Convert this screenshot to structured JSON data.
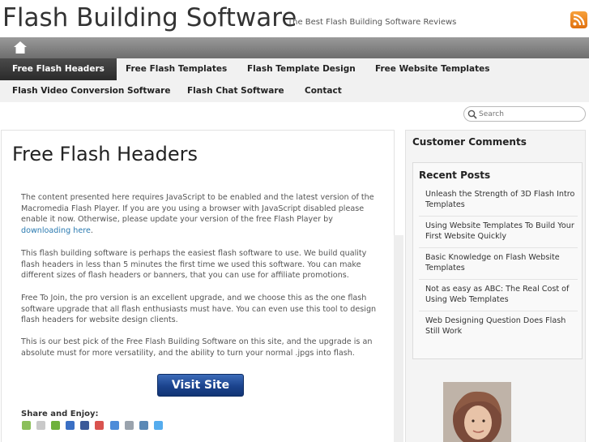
{
  "header": {
    "site_title": "Flash Building Software",
    "tagline": "The Best Flash Building Software Reviews"
  },
  "nav": {
    "items": [
      {
        "label": "Free Flash Headers",
        "active": true
      },
      {
        "label": "Free Flash Templates",
        "active": false
      },
      {
        "label": "Flash Template Design",
        "active": false
      },
      {
        "label": "Free Website Templates",
        "active": false
      },
      {
        "label": "Flash Video Conversion Software",
        "active": false
      },
      {
        "label": "Flash Chat Software",
        "active": false
      },
      {
        "label": "Contact",
        "active": false
      }
    ]
  },
  "search": {
    "placeholder": "Search"
  },
  "main": {
    "title": "Free Flash Headers",
    "p1_text": "The content presented here requires JavaScript to be enabled and the latest version of the Macromedia Flash Player. If you are you using a browser with JavaScript disabled please enable it now. Otherwise, please update your version of the free Flash Player by ",
    "p1_link": "downloading here",
    "p1_end": ".",
    "p2": "This flash building software is perhaps the easiest flash software to use.  We build quality flash headers in less than 5 minutes the first time we used this software.  You can make different sizes of flash headers or banners, that you can use for affiliate promotions.",
    "p3": "Free To Join, the pro version is an excellent upgrade, and we choose this as the one flash software upgrade that all flash enthusiasts must have.  You can even use this tool to design flash headers for website design clients.",
    "p4": "This is our best pick of the Free Flash Building Software on this site, and the upgrade is an absolute must for more versatility, and the ability to turn your normal .jpgs into flash.",
    "visit_button": "Visit Site",
    "share_title": "Share and Enjoy:"
  },
  "sidebar": {
    "customer_comments": "Customer Comments",
    "recent_posts_title": "Recent Posts",
    "recent_posts": [
      "Unleash the Strength of 3D Flash Intro Templates",
      "Using Website Templates To Build Your First Website Quickly",
      "Basic Knowledge on Flash Website Templates",
      "Not as easy as ABC: The Real Cost of Using Web Templates",
      "Web Designing Question Does Flash Still Work"
    ]
  },
  "colors": {
    "accent_link": "#2a7ab0",
    "button_blue": "#1b438d",
    "nav_active": "#2a2a2a"
  }
}
